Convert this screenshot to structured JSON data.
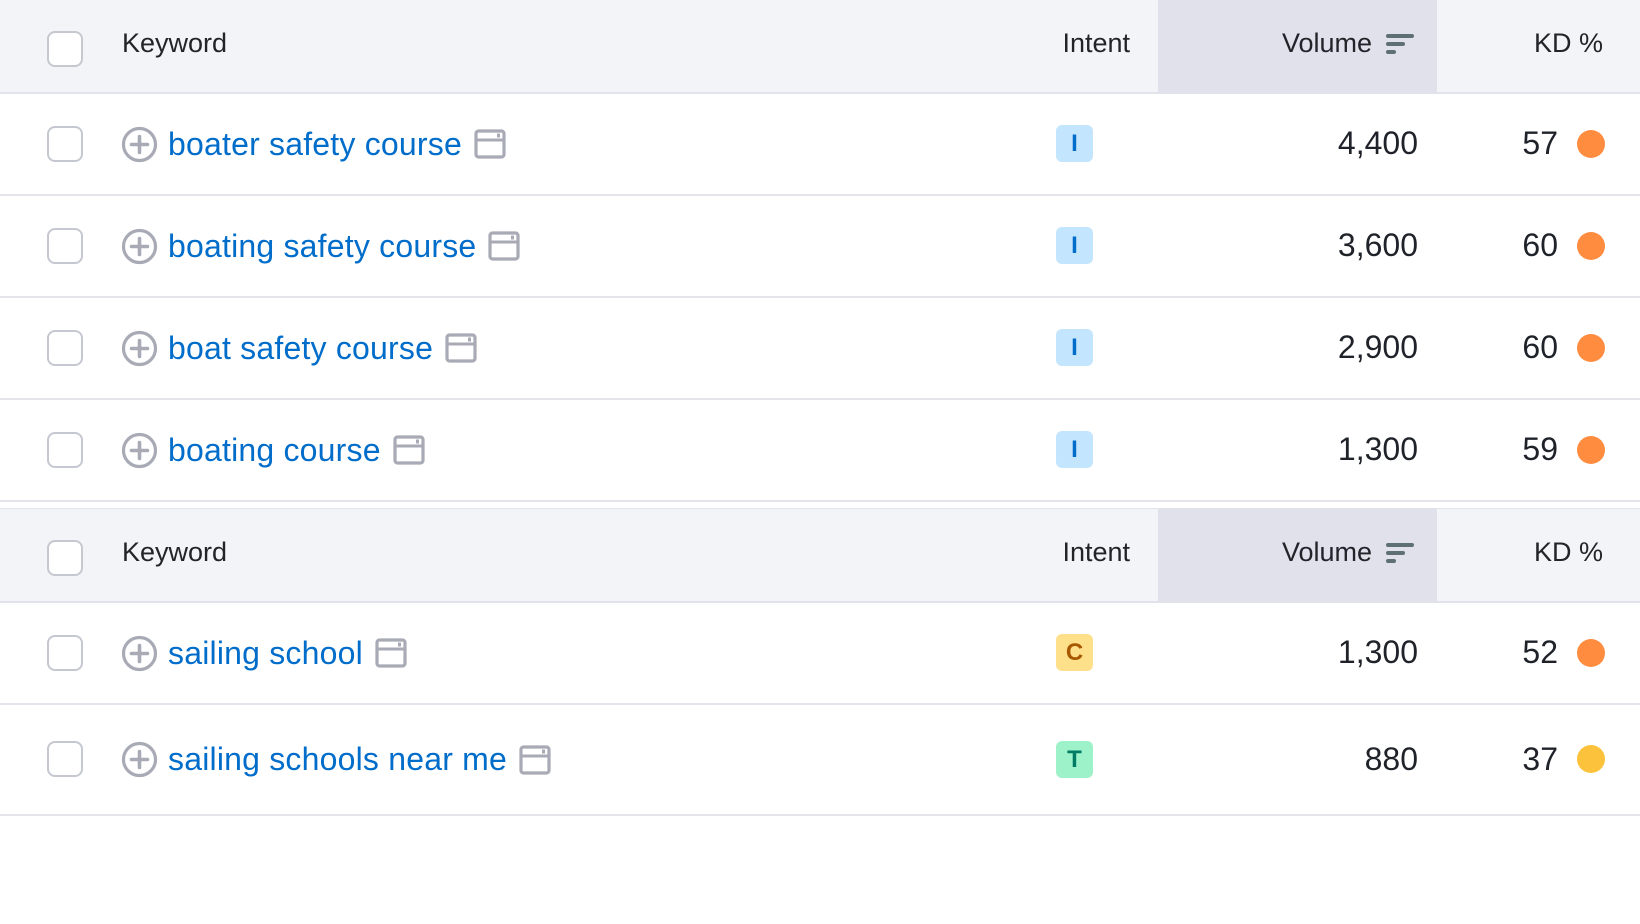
{
  "columns": {
    "keyword": "Keyword",
    "intent": "Intent",
    "volume": "Volume",
    "kd": "KD %",
    "volume_sort_icon": "sort-descending-icon"
  },
  "colors": {
    "link": "#006dca",
    "kd_orange": "#ff8c3f",
    "kd_yellow": "#fdc23c",
    "intent_informational_bg": "#c4e5fe",
    "intent_informational_fg": "#006dca",
    "intent_commercial_bg": "#ffe08a",
    "intent_commercial_fg": "#a75800",
    "intent_transactional_bg": "#9ef2c9",
    "intent_transactional_fg": "#007c65"
  },
  "tables": [
    {
      "rows": [
        {
          "keyword": "boater safety course",
          "intent": "I",
          "intent_type": "informational",
          "volume": "4,400",
          "kd": "57",
          "kd_level": "orange"
        },
        {
          "keyword": "boating safety course",
          "intent": "I",
          "intent_type": "informational",
          "volume": "3,600",
          "kd": "60",
          "kd_level": "orange"
        },
        {
          "keyword": "boat safety course",
          "intent": "I",
          "intent_type": "informational",
          "volume": "2,900",
          "kd": "60",
          "kd_level": "orange"
        },
        {
          "keyword": "boating course",
          "intent": "I",
          "intent_type": "informational",
          "volume": "1,300",
          "kd": "59",
          "kd_level": "orange"
        }
      ]
    },
    {
      "rows": [
        {
          "keyword": "sailing school",
          "intent": "C",
          "intent_type": "commercial",
          "volume": "1,300",
          "kd": "52",
          "kd_level": "orange"
        },
        {
          "keyword": "sailing schools near me",
          "intent": "T",
          "intent_type": "transactional",
          "volume": "880",
          "kd": "37",
          "kd_level": "yellow"
        }
      ]
    }
  ]
}
